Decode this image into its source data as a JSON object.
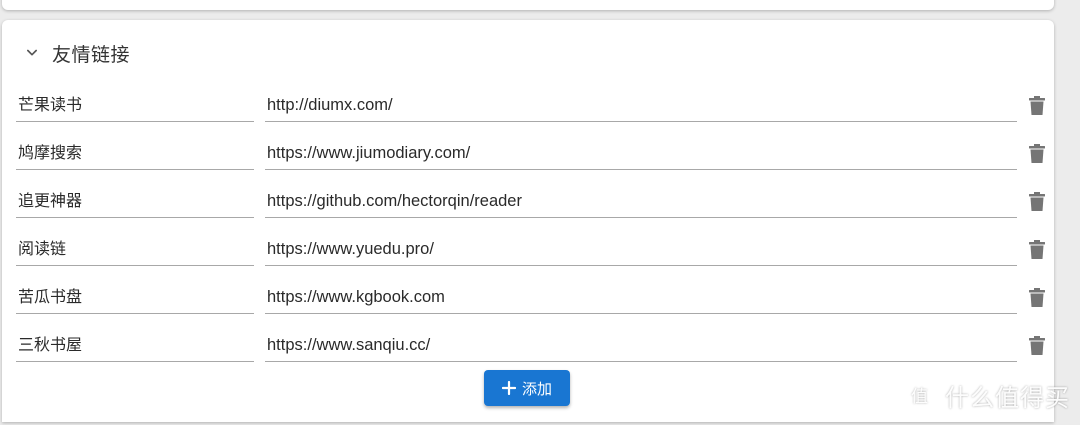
{
  "section": {
    "title": "友情链接"
  },
  "links": [
    {
      "name": "芒果读书",
      "url": "http://diumx.com/"
    },
    {
      "name": "鸠摩搜索",
      "url": "https://www.jiumodiary.com/"
    },
    {
      "name": "追更神器",
      "url": "https://github.com/hectorqin/reader"
    },
    {
      "name": "阅读链",
      "url": "https://www.yuedu.pro/"
    },
    {
      "name": "苦瓜书盘",
      "url": "https://www.kgbook.com"
    },
    {
      "name": "三秋书屋",
      "url": "https://www.sanqiu.cc/"
    }
  ],
  "add_button": {
    "label": "添加"
  },
  "watermark": {
    "text": "什么值得买"
  },
  "colors": {
    "primary": "#1976d2",
    "icon": "#757575"
  }
}
